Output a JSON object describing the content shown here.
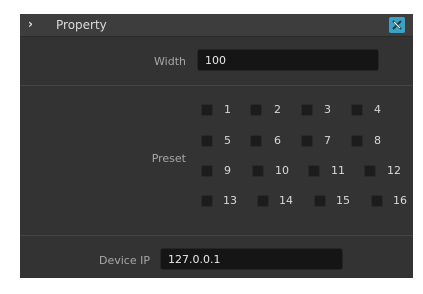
{
  "panel": {
    "title": "Property",
    "chevron": "›",
    "pin_icon": "pin-icon",
    "pin_color": "#3aa2c4"
  },
  "width": {
    "label": "Width",
    "value": "100"
  },
  "preset": {
    "label": "Preset",
    "items": [
      "1",
      "2",
      "3",
      "4",
      "5",
      "6",
      "7",
      "8",
      "9",
      "10",
      "11",
      "12",
      "13",
      "14",
      "15",
      "16"
    ]
  },
  "device_ip": {
    "label": "Device IP",
    "value": "127.0.0.1"
  }
}
